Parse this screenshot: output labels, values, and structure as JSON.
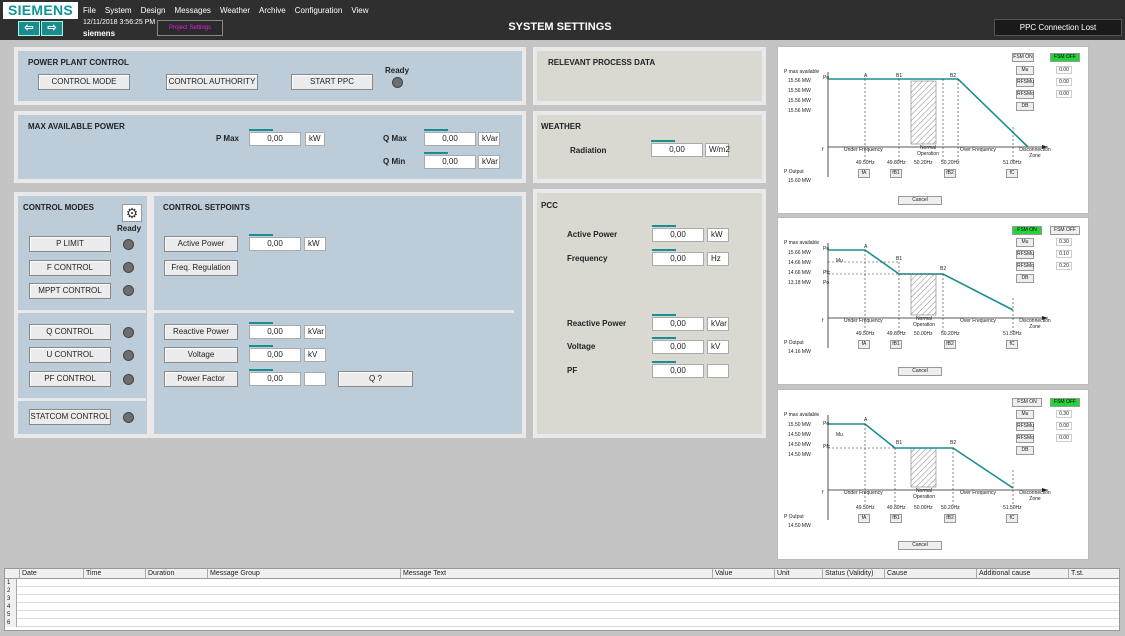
{
  "topbar": {
    "logo": "SIEMENS",
    "back_icon": "arrow-left-icon",
    "forward_icon": "arrow-right-icon",
    "menu": [
      "File",
      "System",
      "Design",
      "Messages",
      "Weather",
      "Archive",
      "Configuration",
      "View"
    ],
    "datetime": "12/11/2018 3:56:25 PM",
    "user": "siemens",
    "status_slot": "Project Settings",
    "title": "SYSTEM SETTINGS",
    "connection": "PPC Connection Lost"
  },
  "plant_control": {
    "title": "POWER PLANT CONTROL",
    "control_mode": "CONTROL MODE",
    "control_authority": "CONTROL AUTHORITY",
    "start_ppc": "START PPC",
    "ready": "Ready"
  },
  "relevant": {
    "title": "RELEVANT PROCESS DATA"
  },
  "max_power": {
    "title": "MAX AVAILABLE POWER",
    "pmax_label": "P Max",
    "pmax_value": "0,00",
    "pmax_unit": "kW",
    "qmax_label": "Q Max",
    "qmax_value": "0,00",
    "qmax_unit": "kVar",
    "qmin_label": "Q Min",
    "qmin_value": "0,00",
    "qmin_unit": "kVar"
  },
  "weather": {
    "title": "WEATHER",
    "radiation_label": "Radiation",
    "radiation_value": "0,00",
    "radiation_unit": "W/m2"
  },
  "control_modes": {
    "title": "CONTROL MODES",
    "ready": "Ready",
    "gear_icon": "gear-icon",
    "p_limit": "P LIMIT",
    "f_control": "F CONTROL",
    "mppt_control": "MPPT CONTROL",
    "q_control": "Q CONTROL",
    "u_control": "U CONTROL",
    "pf_control": "PF CONTROL",
    "statcom_control": "STATCOM CONTROL"
  },
  "setpoints": {
    "title": "CONTROL SETPOINTS",
    "active_power": "Active Power",
    "active_power_value": "0,00",
    "active_power_unit": "kW",
    "freq_regulation": "Freq. Regulation",
    "reactive_power": "Reactive Power",
    "reactive_power_value": "0,00",
    "reactive_power_unit": "kVar",
    "voltage": "Voltage",
    "voltage_value": "0,00",
    "voltage_unit": "kV",
    "power_factor": "Power Factor",
    "power_factor_value": "0,00",
    "power_factor_unit": "",
    "q_help": "Q ?"
  },
  "pcc": {
    "title": "PCC",
    "active_power_label": "Active Power",
    "active_power_value": "0,00",
    "active_power_unit": "kW",
    "frequency_label": "Frequency",
    "frequency_value": "0,00",
    "frequency_unit": "Hz",
    "reactive_power_label": "Reactive Power",
    "reactive_power_value": "0,00",
    "reactive_power_unit": "kVar",
    "voltage_label": "Voltage",
    "voltage_value": "0,00",
    "voltage_unit": "kV",
    "pf_label": "PF",
    "pf_value": "0,00",
    "pf_unit": ""
  },
  "diagrams": [
    {
      "pmax_label": "P max available",
      "pmax_rows": [
        "15.56  MW",
        "15.56  MW",
        "15.56  MW",
        "15.56  MW"
      ],
      "fsm_on": "FSM ON",
      "fsm_off": "FSM OFF",
      "active": "off",
      "params": [
        {
          "label": "Mu",
          "value": "0.00"
        },
        {
          "label": "RFSMu",
          "value": "0.00"
        },
        {
          "label": "RFSMo",
          "value": "0.00"
        },
        {
          "label": "DB",
          "value": ""
        }
      ],
      "points": [
        "A",
        "B1",
        "B2"
      ],
      "f_label": "f",
      "zones": [
        "Under Frequency",
        "Normal Operation",
        "Over Frequency",
        "Disconnection Zone"
      ],
      "pe_label": "Pe",
      "freqs": [
        "49.50Hz",
        "49.80Hz",
        "50.20Hz",
        "50.20Hz",
        "51.00Hz"
      ],
      "freq_btns": [
        "fA",
        "fB1",
        "fB2",
        "fC"
      ],
      "poutput_label": "P Output",
      "poutput_value": "15.60  MW",
      "cancel": "Cancel"
    },
    {
      "pmax_label": "P max available",
      "pmax_rows": [
        "15.66  MW",
        "14.66  MW",
        "14.66  MW",
        "13.18  MW"
      ],
      "fsm_on": "FSM ON",
      "fsm_off": "FSM OFF",
      "active": "on",
      "params": [
        {
          "label": "Mu",
          "value": "0.30"
        },
        {
          "label": "RFSMu",
          "value": "0.10"
        },
        {
          "label": "RFSMo",
          "value": "0.20"
        },
        {
          "label": "DB",
          "value": ""
        }
      ],
      "points": [
        "A",
        "B1",
        "B2"
      ],
      "f_label": "f",
      "zones": [
        "Under Frequency",
        "Normal Operation",
        "Over Frequency",
        "Disconnection Zone"
      ],
      "pe_label": "Pe",
      "mu_label": "Mu",
      "pfc_label": "Pfc",
      "po_label": "Po",
      "freqs": [
        "49.50Hz",
        "49.80Hz",
        "50.00Hz",
        "50.20Hz",
        "51.50Hz"
      ],
      "freq_btns": [
        "fA",
        "fB1",
        "fB2",
        "fC"
      ],
      "poutput_label": "P Output",
      "poutput_value": "14.16  MW",
      "cancel": "Cancel"
    },
    {
      "pmax_label": "P max available",
      "pmax_rows": [
        "15.50  MW",
        "14.50  MW",
        "14.50  MW",
        "14.50  MW"
      ],
      "fsm_on": "FSM ON",
      "fsm_off": "FSM OFF",
      "active": "off",
      "params": [
        {
          "label": "Mu",
          "value": "0.30"
        },
        {
          "label": "RFSMu",
          "value": "0.00"
        },
        {
          "label": "RFSMo",
          "value": "0.00"
        },
        {
          "label": "DB",
          "value": ""
        }
      ],
      "points": [
        "A",
        "B1",
        "B2"
      ],
      "f_label": "f",
      "zones": [
        "Under Frequency",
        "Normal Operation",
        "Over Frequency",
        "Disconnection Zone"
      ],
      "pe_label": "Pe",
      "mu_label": "Mu",
      "pfc_label": "Pfc",
      "freqs": [
        "49.50Hz",
        "49.80Hz",
        "50.00Hz",
        "50.20Hz",
        "51.50Hz"
      ],
      "freq_btns": [
        "fA",
        "fB1",
        "fB2",
        "fC"
      ],
      "poutput_label": "P Output",
      "poutput_value": "14.50  MW",
      "cancel": "Cancel"
    }
  ],
  "messages": {
    "columns": [
      "Date",
      "Time",
      "Duration",
      "Message Group",
      "Message Text",
      "Value",
      "Unit",
      "Status (Validity)",
      "Cause",
      "Additional cause",
      "T.st."
    ],
    "rows": [
      "1",
      "2",
      "3",
      "4",
      "5",
      "6"
    ]
  },
  "colors": {
    "accent": "#1b8d8f",
    "fsm_on": "#23d33a",
    "panel_blue": "#bcccd9",
    "panel_gray": "#d9d9d2"
  }
}
